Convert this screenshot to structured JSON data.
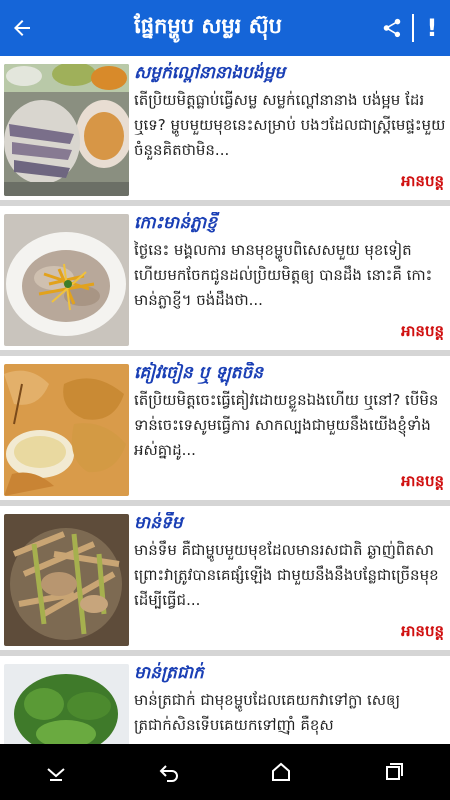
{
  "appbar": {
    "title": "ផ្នែកម្ហូប សម្លរ ស៊ុប",
    "back_icon": "arrow-left-icon",
    "share_icon": "share-icon",
    "more_icon": "info-exclamation-icon"
  },
  "colors": {
    "appbar": "#1565d8",
    "title": "#1a3fb5",
    "read_more": "#d01010"
  },
  "articles": [
    {
      "title": "សម្លក់ល្ពៅនានាងបង់ម្អម",
      "excerpt": "តើប្រិយមិត្តធ្លាប់ធ្វើសម្ល សម្លក់ល្ពៅនានាង បង់ម្អម ដែរ ឬទេ? ម្ហូបមួយមុខនេះសម្រាប់ បងៗដែលជាស្ត្រីមេផ្ទះមួយចំនួនគិតថាមិន...",
      "read_more": "អានបន្ត"
    },
    {
      "title": "កោះមាន់ភ្លាខ្ញី",
      "excerpt": "ថ្ងៃនេះ មង្គលការ មានមុខម្ហូបពិសេសមួយ មុខទៀតហើយមកចែកជូនដល់ប្រិយមិត្តឲ្យ បានដឹង នោះគឺ កោះមាន់ភ្លាខ្ញី។ ចង់ដឹងថា...",
      "read_more": "អានបន្ត"
    },
    {
      "title": "គៀវចៀន ឬ ឡុតចិន",
      "excerpt": "តើប្រិយមិត្តចេះធ្វើគៀវដោយខ្លួនឯងហើយ ឬនៅ? បើមិនទាន់ចេះទេសូមធ្វើការ សាកល្បងជាមួយនឹងយើងខ្ញុំទាំងអស់គ្នាដូ...",
      "read_more": "អានបន្ត"
    },
    {
      "title": "មាន់ទឹម",
      "excerpt": "មាន់ទឹម គឺជាម្ហូបមួយមុខដែលមានរសជាតិ ឆ្ងាញ់ពិតសា ព្រោះវាត្រូវបានគេផ្សំឡើង ជាមួយនឹងនឹងបន្លែជាច្រើនមុខដើម្បីធ្វើជ...",
      "read_more": "អានបន្ត"
    },
    {
      "title": "មាន់ត្រជាក់",
      "excerpt": "មាន់ត្រជាក់ ជាមុខម្ហូបដែលគេយកវាទៅក្លា សេឲ្យត្រជាក់សិនទើបគេយកទៅញ៉ាំ គឺខុស",
      "read_more": ""
    }
  ],
  "navbar": {
    "items": [
      "chevron-down-icon",
      "back-arrow-icon",
      "home-icon",
      "recents-icon"
    ]
  }
}
